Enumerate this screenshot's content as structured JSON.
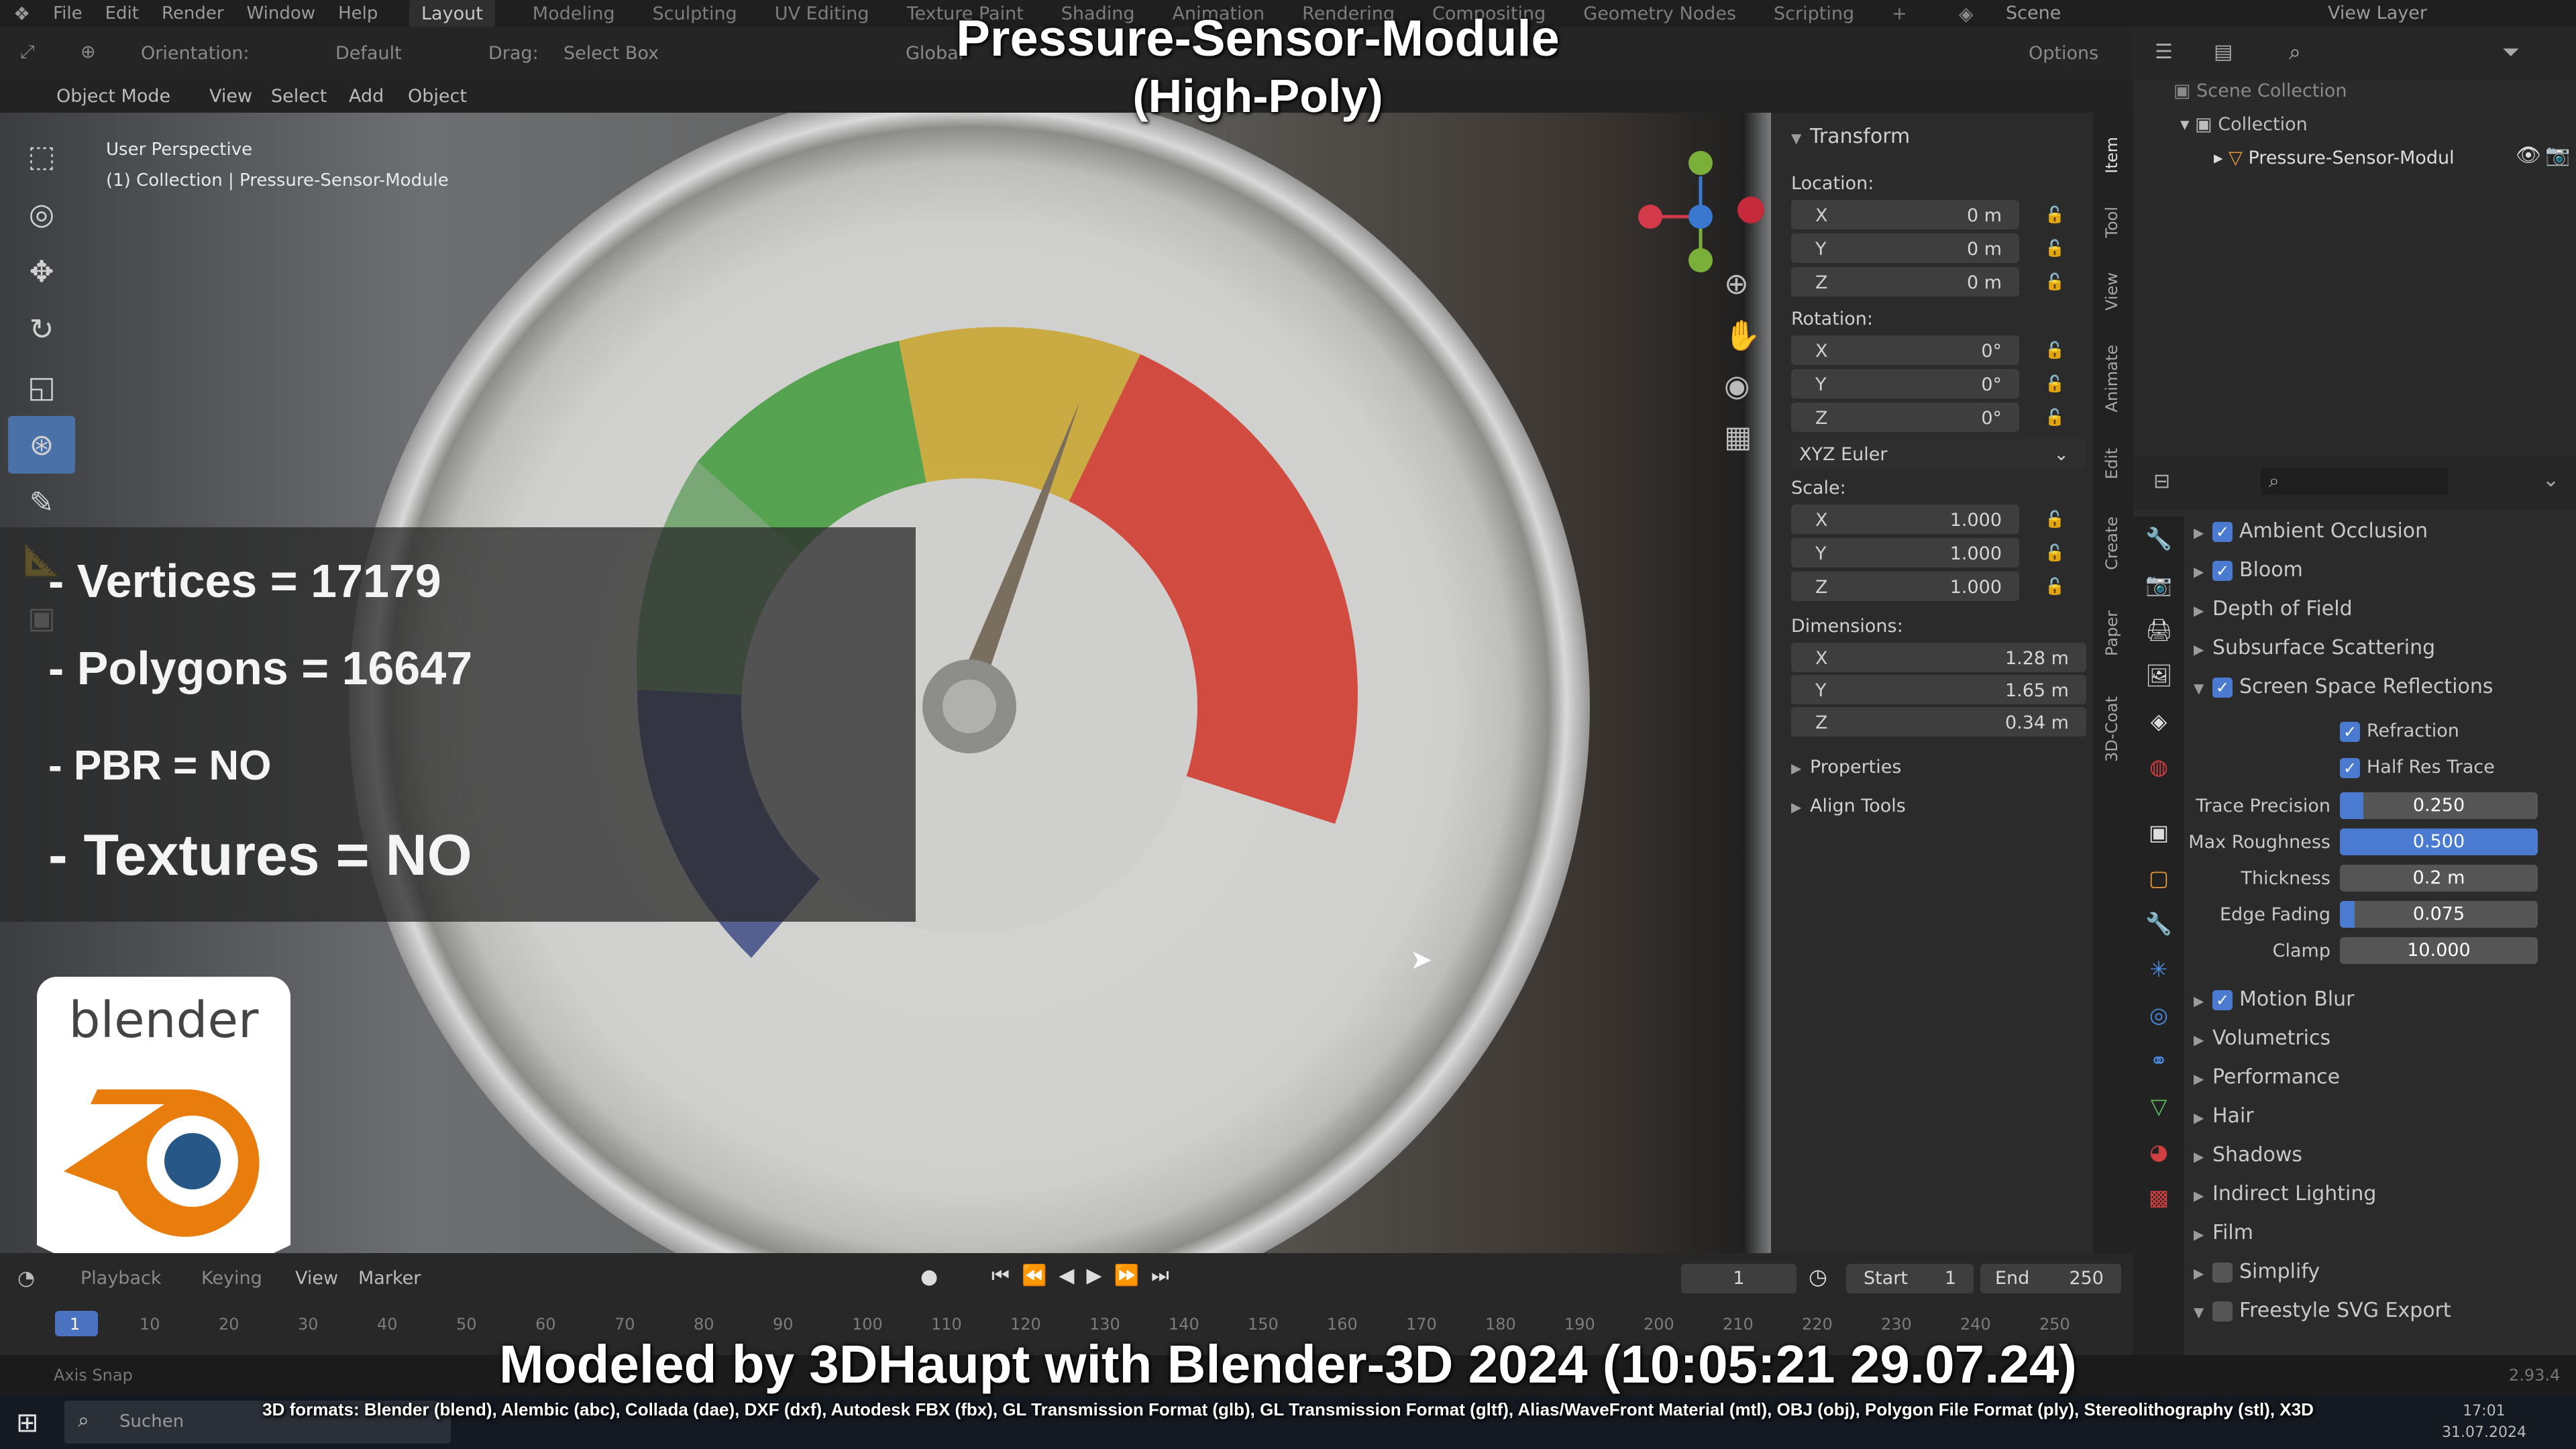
{
  "menu": [
    "File",
    "Edit",
    "Render",
    "Window",
    "Help"
  ],
  "workspace_tabs": [
    "Layout",
    "Modeling",
    "Sculpting",
    "UV Editing",
    "Texture Paint",
    "Shading",
    "Animation",
    "Rendering",
    "Compositing",
    "Geometry Nodes",
    "Scripting"
  ],
  "scene": "Scene",
  "view_layer": "View Layer",
  "header": {
    "orientation_label": "Orientation:",
    "orientation_value": "Default",
    "drag_label": "Drag:",
    "drag_value": "Select Box",
    "global": "Global",
    "options": "Options",
    "mode": "Object Mode",
    "view": "View",
    "select": "Select",
    "add": "Add",
    "object": "Object"
  },
  "viewport": {
    "perspective": "User Perspective",
    "collection_path": "(1) Collection | Pressure-Sensor-Module"
  },
  "title": {
    "line1": "Pressure-Sensor-Module",
    "line2": "(High-Poly)"
  },
  "stats": {
    "vertices": "- Vertices = 17179",
    "polygons": "- Polygons = 16647",
    "pbr": "- PBR =  NO",
    "textures": "- Textures = NO"
  },
  "logo": {
    "text": "blender"
  },
  "transform": {
    "header": "Transform",
    "location_label": "Location:",
    "location": {
      "x": "0 m",
      "y": "0 m",
      "z": "0 m"
    },
    "rotation_label": "Rotation:",
    "rotation": {
      "x": "0°",
      "y": "0°",
      "z": "0°"
    },
    "rotation_mode": "XYZ Euler",
    "scale_label": "Scale:",
    "scale": {
      "x": "1.000",
      "y": "1.000",
      "z": "1.000"
    },
    "dimensions_label": "Dimensions:",
    "dimensions": {
      "x": "1.28 m",
      "y": "1.65 m",
      "z": "0.34 m"
    },
    "properties": "Properties",
    "align_tools": "Align Tools",
    "axes": {
      "x": "X",
      "y": "Y",
      "z": "Z"
    }
  },
  "npanel_tabs": [
    "Item",
    "Tool",
    "View",
    "Animate",
    "Edit",
    "Create",
    "Paper",
    "3D-Coat"
  ],
  "outliner": {
    "scene_collection": "Scene Collection",
    "collection": "Collection",
    "object": "Pressure-Sensor-Modul"
  },
  "render_props": {
    "ambient_occlusion": "Ambient Occlusion",
    "bloom": "Bloom",
    "depth_of_field": "Depth of Field",
    "subsurface_scattering": "Subsurface Scattering",
    "screen_space_reflections": "Screen Space Reflections",
    "refraction": "Refraction",
    "half_res_trace": "Half Res Trace",
    "trace_precision_label": "Trace Precision",
    "trace_precision": "0.250",
    "max_roughness_label": "Max Roughness",
    "max_roughness": "0.500",
    "thickness_label": "Thickness",
    "thickness": "0.2 m",
    "edge_fading_label": "Edge Fading",
    "edge_fading": "0.075",
    "clamp_label": "Clamp",
    "clamp": "10.000",
    "motion_blur": "Motion Blur",
    "volumetrics": "Volumetrics",
    "performance": "Performance",
    "hair": "Hair",
    "shadows": "Shadows",
    "indirect_lighting": "Indirect Lighting",
    "film": "Film",
    "simplify": "Simplify",
    "freestyle": "Freestyle SVG Export",
    "slider_levels": {
      "trace_precision": 0.12,
      "max_roughness": 1.0,
      "edge_fading": 0.075,
      "thickness": 0,
      "clamp": 0
    }
  },
  "timeline": {
    "playback": "Playback",
    "keying": "Keying",
    "view": "View",
    "marker": "Marker",
    "current_frame": "1",
    "start_label": "Start",
    "start": "1",
    "end_label": "End",
    "end": "250",
    "ticks": [
      "1",
      "10",
      "20",
      "30",
      "40",
      "50",
      "60",
      "70",
      "80",
      "90",
      "100",
      "110",
      "120",
      "130",
      "140",
      "150",
      "160",
      "170",
      "180",
      "190",
      "200",
      "210",
      "220",
      "230",
      "240",
      "250"
    ]
  },
  "status": {
    "axis_snap": "Axis Snap",
    "version": "2.93.4"
  },
  "footer": {
    "credit": "Modeled by 3DHaupt with Blender-3D 2024 (10:05:21  29.07.24)",
    "formats": "3D formats: Blender (blend), Alembic (abc), Collada (dae), DXF (dxf), Autodesk FBX (fbx), GL Transmission Format (glb), GL Transmission Format (gltf), Alias/WaveFront Material (mtl), OBJ (obj), Polygon File Format (ply), Stereolithography (stl), X3D"
  },
  "taskbar": {
    "search": "Suchen",
    "time": "17:01",
    "date": "31.07.2024"
  },
  "colors": {
    "accent": "#4a7bd0",
    "axis_x": "#d23a4a",
    "axis_y": "#7ab03a",
    "axis_z": "#3a78d0"
  }
}
